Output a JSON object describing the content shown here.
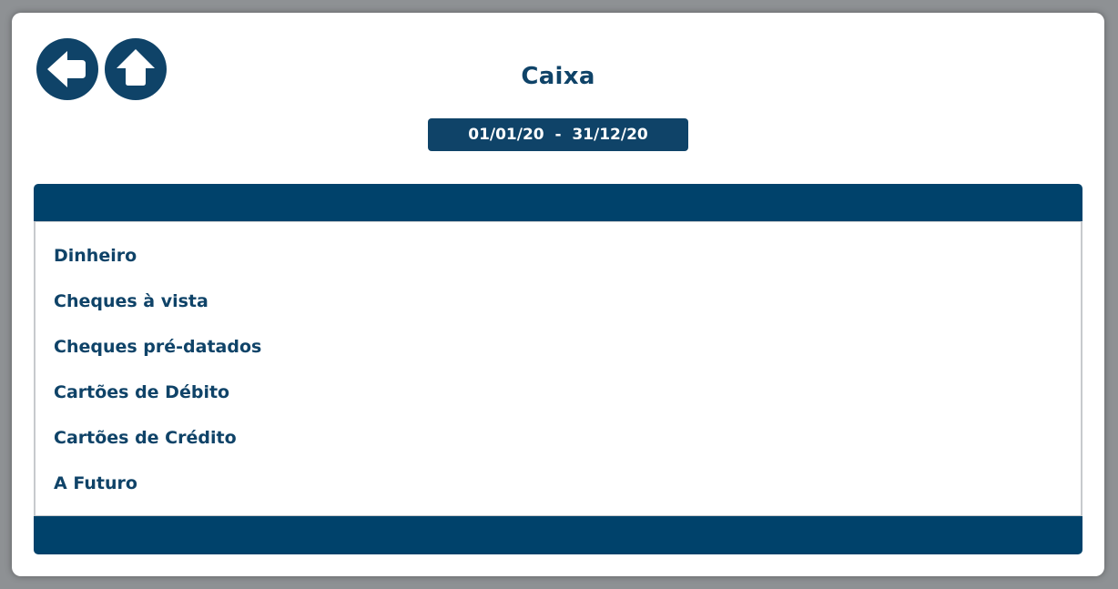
{
  "header": {
    "title": "Caixa",
    "back_icon": "arrow-left-icon",
    "home_icon": "arrow-up-icon"
  },
  "period": {
    "start": "01/01/20",
    "separator": "-",
    "end": "31/12/20",
    "label": "01/01/20  -  31/12/20"
  },
  "list": {
    "items": [
      {
        "label": "Dinheiro"
      },
      {
        "label": "Cheques à vista"
      },
      {
        "label": "Cheques pré-datados"
      },
      {
        "label": "Cartões de Débito"
      },
      {
        "label": "Cartões de Crédito"
      },
      {
        "label": "A Futuro"
      }
    ]
  },
  "colors": {
    "primary": "#0f4368",
    "panel_bar": "#00426b",
    "background": "#ffffff"
  }
}
